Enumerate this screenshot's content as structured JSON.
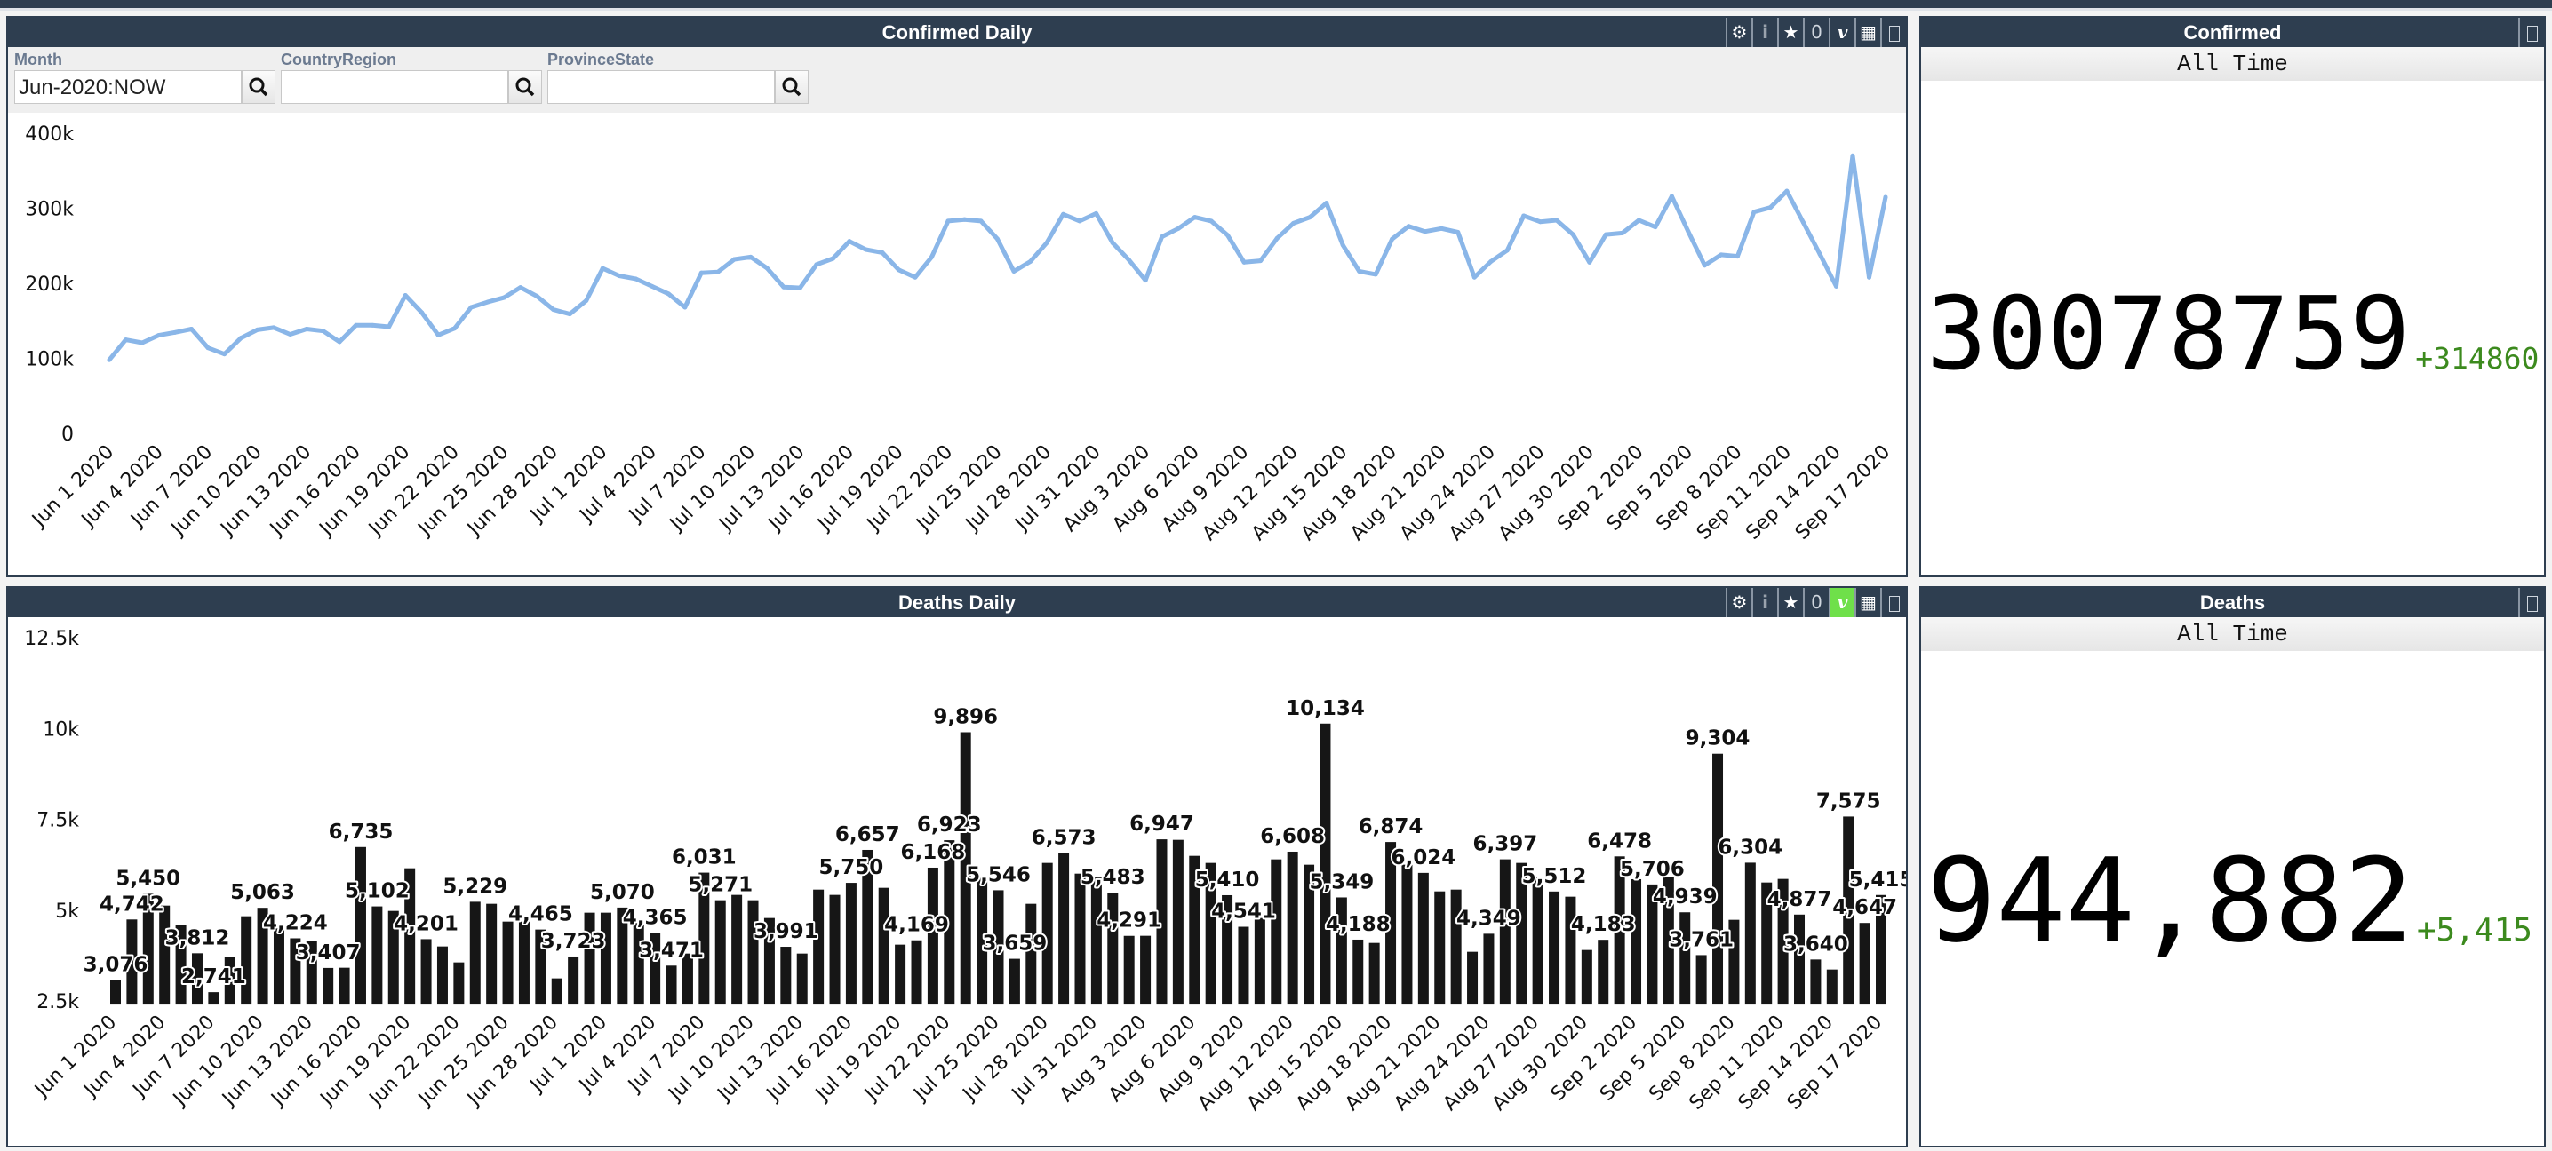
{
  "confirmed_daily": {
    "title": "Confirmed Daily",
    "toolbar": {
      "gear": "gear-icon",
      "info": "i",
      "star": "star-icon",
      "count": "0",
      "v": "v",
      "table": "table-icon",
      "maximize": "maximize-icon",
      "v_active": false
    },
    "filters": [
      {
        "label": "Month",
        "value": "Jun-2020:NOW",
        "placeholder": ""
      },
      {
        "label": "CountryRegion",
        "value": "",
        "placeholder": ""
      },
      {
        "label": "ProvinceState",
        "value": "",
        "placeholder": ""
      }
    ]
  },
  "deaths_daily": {
    "title": "Deaths Daily",
    "toolbar": {
      "gear": "gear-icon",
      "info": "i",
      "star": "star-icon",
      "count": "0",
      "v": "v",
      "table": "table-icon",
      "maximize": "maximize-icon",
      "v_active": true,
      "v_active_color": "#6fe04a"
    }
  },
  "confirmed_total": {
    "title": "Confirmed",
    "period": "All Time",
    "value": "30078759",
    "delta": "+314860",
    "delta_color": "#3c8a1e"
  },
  "deaths_total": {
    "title": "Deaths",
    "period": "All Time",
    "value": "944,882",
    "delta": "+5,415",
    "delta_color": "#3c8a1e"
  },
  "chart_data": [
    {
      "type": "line",
      "color": "#8ab6e8",
      "ylim": [
        0,
        400000
      ],
      "y_ticks": [
        "0",
        "100k",
        "200k",
        "300k",
        "400k"
      ],
      "y_tick_values": [
        0,
        100000,
        200000,
        300000,
        400000
      ],
      "x_ticks": [
        "Jun 1 2020",
        "Jun 4 2020",
        "Jun 7 2020",
        "Jun 10 2020",
        "Jun 13 2020",
        "Jun 16 2020",
        "Jun 19 2020",
        "Jun 22 2020",
        "Jun 25 2020",
        "Jun 28 2020",
        "Jul 1 2020",
        "Jul 4 2020",
        "Jul 7 2020",
        "Jul 10 2020",
        "Jul 13 2020",
        "Jul 16 2020",
        "Jul 19 2020",
        "Jul 22 2020",
        "Jul 25 2020",
        "Jul 28 2020",
        "Jul 31 2020",
        "Aug 3 2020",
        "Aug 6 2020",
        "Aug 9 2020",
        "Aug 12 2020",
        "Aug 15 2020",
        "Aug 18 2020",
        "Aug 21 2020",
        "Aug 24 2020",
        "Aug 27 2020",
        "Aug 30 2020",
        "Sep 2 2020",
        "Sep 5 2020",
        "Sep 8 2020",
        "Sep 11 2020",
        "Sep 14 2020",
        "Sep 17 2020"
      ],
      "x_tick_every_days": 3,
      "values": [
        98000,
        124700,
        120700,
        130600,
        134500,
        139000,
        114000,
        105700,
        127000,
        138000,
        141000,
        132000,
        139000,
        136500,
        122000,
        144000,
        144000,
        142000,
        184000,
        161000,
        131000,
        140000,
        168000,
        175000,
        181000,
        194500,
        183000,
        165000,
        159000,
        177000,
        220000,
        210000,
        206000,
        196000,
        186000,
        168000,
        214000,
        215000,
        232000,
        235000,
        220000,
        195000,
        194000,
        225000,
        233000,
        256000,
        245000,
        241000,
        218000,
        208000,
        235000,
        283000,
        285000,
        283000,
        259000,
        216000,
        229000,
        254000,
        292000,
        283000,
        293000,
        254000,
        231000,
        204000,
        262000,
        273000,
        288000,
        283000,
        264000,
        228000,
        230000,
        260000,
        280000,
        288000,
        307000,
        251000,
        216000,
        212000,
        259000,
        276000,
        269000,
        273000,
        268000,
        208000,
        229000,
        244000,
        290000,
        282000,
        284000,
        265000,
        228000,
        265000,
        267000,
        284000,
        275000,
        316000,
        269000,
        224000,
        238000,
        236000,
        295000,
        301000,
        323000,
        281000,
        239000,
        196000,
        370000,
        208000,
        314860
      ]
    },
    {
      "type": "bar",
      "color": "#161616",
      "ylim": [
        2400,
        12500
      ],
      "y_ticks": [
        "2.5k",
        "5k",
        "7.5k",
        "10k",
        "12.5k"
      ],
      "y_tick_values": [
        2500,
        5000,
        7500,
        10000,
        12500
      ],
      "x_ticks": [
        "Jun 1 2020",
        "Jun 4 2020",
        "Jun 7 2020",
        "Jun 10 2020",
        "Jun 13 2020",
        "Jun 16 2020",
        "Jun 19 2020",
        "Jun 22 2020",
        "Jun 25 2020",
        "Jun 28 2020",
        "Jul 1 2020",
        "Jul 4 2020",
        "Jul 7 2020",
        "Jul 10 2020",
        "Jul 13 2020",
        "Jul 16 2020",
        "Jul 19 2020",
        "Jul 22 2020",
        "Jul 25 2020",
        "Jul 28 2020",
        "Jul 31 2020",
        "Aug 3 2020",
        "Aug 6 2020",
        "Aug 9 2020",
        "Aug 12 2020",
        "Aug 15 2020",
        "Aug 18 2020",
        "Aug 21 2020",
        "Aug 24 2020",
        "Aug 27 2020",
        "Aug 30 2020",
        "Sep 2 2020",
        "Sep 5 2020",
        "Sep 8 2020",
        "Sep 11 2020",
        "Sep 14 2020",
        "Sep 17 2020"
      ],
      "x_tick_every_days": 3,
      "values": [
        3076,
        4742,
        5450,
        5124,
        4586,
        3812,
        2741,
        3706,
        4831,
        5063,
        4600,
        4224,
        4146,
        3407,
        3413,
        6735,
        5102,
        4977,
        6151,
        4201,
        4000,
        3560,
        5229,
        5173,
        4684,
        4684,
        4465,
        3120,
        3723,
        4929,
        4929,
        5070,
        4700,
        4365,
        3471,
        3804,
        6031,
        5271,
        5418,
        5271,
        4782,
        3991,
        3804,
        5564,
        5418,
        5750,
        6657,
        5613,
        4049,
        4169,
        6168,
        6923,
        9896,
        5900,
        5546,
        3659,
        5173,
        6298,
        6573,
        6004,
        5923,
        5483,
        4291,
        4293,
        6947,
        6933,
        6493,
        6298,
        5410,
        4541,
        4782,
        6396,
        6608,
        6249,
        10134,
        5349,
        4188,
        4097,
        6874,
        6249,
        6024,
        5515,
        5564,
        3853,
        4349,
        6397,
        6298,
        5923,
        5512,
        5369,
        3902,
        4183,
        6478,
        5850,
        5706,
        5907,
        4939,
        3761,
        9304,
        4733,
        6304,
        5760,
        5858,
        4877,
        3640,
        3364,
        7575,
        4647,
        5415
      ],
      "labeled_indices": [
        0,
        1,
        2,
        5,
        6,
        9,
        11,
        13,
        15,
        16,
        19,
        22,
        26,
        28,
        31,
        33,
        34,
        36,
        37,
        41,
        45,
        46,
        49,
        50,
        51,
        52,
        54,
        55,
        58,
        61,
        62,
        64,
        68,
        69,
        72,
        74,
        75,
        76,
        78,
        80,
        84,
        85,
        88,
        91,
        92,
        94,
        96,
        97,
        98,
        100,
        103,
        104,
        106,
        107,
        108
      ]
    }
  ]
}
